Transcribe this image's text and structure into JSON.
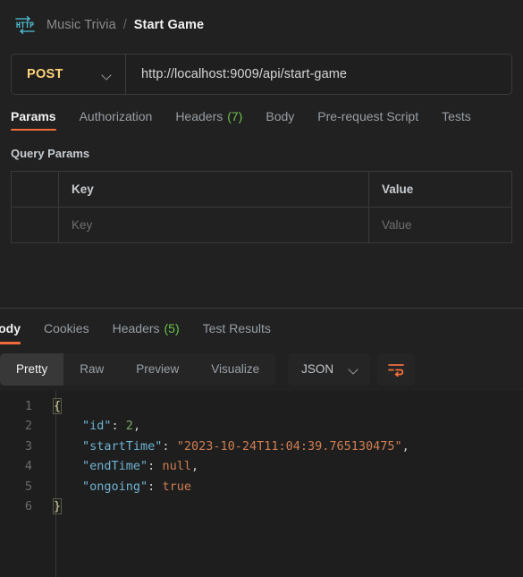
{
  "breadcrumb": {
    "icon": "http-protocol-icon",
    "parent": "Music Trivia",
    "separator": "/",
    "current": "Start Game"
  },
  "url_bar": {
    "method": "POST",
    "method_chevron": "chevron-down-icon",
    "url": "http://localhost:9009/api/start-game"
  },
  "request_tabs": [
    {
      "label": "Params",
      "count": null,
      "active": true
    },
    {
      "label": "Authorization",
      "count": null,
      "active": false
    },
    {
      "label": "Headers",
      "count": "(7)",
      "active": false
    },
    {
      "label": "Body",
      "count": null,
      "active": false
    },
    {
      "label": "Pre-request Script",
      "count": null,
      "active": false
    },
    {
      "label": "Tests",
      "count": null,
      "active": false
    }
  ],
  "query_params": {
    "title": "Query Params",
    "headers": [
      "",
      "Key",
      "Value"
    ],
    "rows": [
      {
        "check": "",
        "key": "Key",
        "value": "Value",
        "is_placeholder": true
      }
    ]
  },
  "response_tabs": [
    {
      "label": "Body",
      "count": null,
      "active": true
    },
    {
      "label": "Cookies",
      "count": null,
      "active": false
    },
    {
      "label": "Headers",
      "count": "(5)",
      "active": false
    },
    {
      "label": "Test Results",
      "count": null,
      "active": false
    }
  ],
  "format_toolbar": {
    "views": [
      {
        "label": "Pretty",
        "active": true
      },
      {
        "label": "Raw",
        "active": false
      },
      {
        "label": "Preview",
        "active": false
      },
      {
        "label": "Visualize",
        "active": false
      }
    ],
    "language": "JSON",
    "language_chevron": "chevron-down-icon",
    "wrap_button": "word-wrap-icon"
  },
  "response_body": {
    "language": "json",
    "lines": [
      {
        "number": "1",
        "indent": 0,
        "tokens": [
          {
            "t": "brace",
            "v": "{"
          }
        ]
      },
      {
        "number": "2",
        "indent": 1,
        "tokens": [
          {
            "t": "key",
            "v": "\"id\""
          },
          {
            "t": "punct",
            "v": ":"
          },
          {
            "t": "plain",
            "v": " "
          },
          {
            "t": "num",
            "v": "2"
          },
          {
            "t": "punct",
            "v": ","
          }
        ]
      },
      {
        "number": "3",
        "indent": 1,
        "tokens": [
          {
            "t": "key",
            "v": "\"startTime\""
          },
          {
            "t": "punct",
            "v": ":"
          },
          {
            "t": "plain",
            "v": " "
          },
          {
            "t": "str",
            "v": "\"2023-10-24T11:04:39.765130475\""
          },
          {
            "t": "punct",
            "v": ","
          }
        ]
      },
      {
        "number": "4",
        "indent": 1,
        "tokens": [
          {
            "t": "key",
            "v": "\"endTime\""
          },
          {
            "t": "punct",
            "v": ":"
          },
          {
            "t": "plain",
            "v": " "
          },
          {
            "t": "null",
            "v": "null"
          },
          {
            "t": "punct",
            "v": ","
          }
        ]
      },
      {
        "number": "5",
        "indent": 1,
        "tokens": [
          {
            "t": "key",
            "v": "\"ongoing\""
          },
          {
            "t": "punct",
            "v": ":"
          },
          {
            "t": "plain",
            "v": " "
          },
          {
            "t": "bool",
            "v": "true"
          }
        ]
      },
      {
        "number": "6",
        "indent": 0,
        "tokens": [
          {
            "t": "brace",
            "v": "}"
          }
        ]
      }
    ],
    "parsed": {
      "id": 2,
      "startTime": "2023-10-24T11:04:39.765130475",
      "endTime": null,
      "ongoing": true
    }
  },
  "colors": {
    "accent": "#f26b3a",
    "method": "#ffd479",
    "count_badge": "#6cc24a",
    "icon": "#4fc3d9",
    "background": "#212121",
    "code_background": "#1e1e1e",
    "json_key": "#6fb3d2",
    "json_string": "#cf7d52",
    "json_number": "#7aa66a"
  }
}
